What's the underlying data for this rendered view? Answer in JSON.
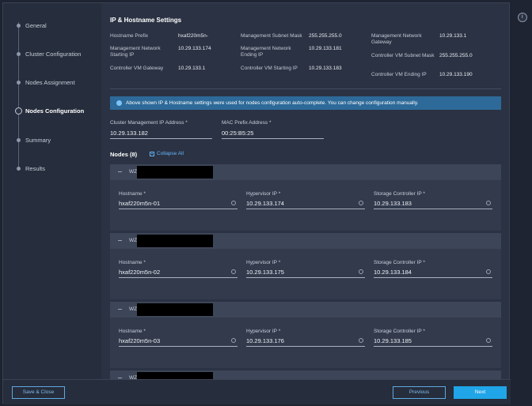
{
  "wizard": {
    "steps": [
      {
        "label": "General",
        "active": false
      },
      {
        "label": "Cluster Configuration",
        "active": false
      },
      {
        "label": "Nodes Assignment",
        "active": false
      },
      {
        "label": "Nodes Configuration",
        "active": true
      },
      {
        "label": "Summary",
        "active": false
      },
      {
        "label": "Results",
        "active": false
      }
    ]
  },
  "settings": {
    "title": "IP & Hostname Settings",
    "col1": [
      {
        "label": "Hostname Prefix",
        "value": "hxaf220m5n-"
      },
      {
        "label": "Management Network Starting IP",
        "value": "10.29.133.174"
      },
      {
        "label": "Controller VM Gateway",
        "value": "10.29.133.1"
      }
    ],
    "col2": [
      {
        "label": "Management Subnet Mask",
        "value": "255.255.255.0"
      },
      {
        "label": "Management Network Ending IP",
        "value": "10.29.133.181"
      },
      {
        "label": "Controller VM Starting IP",
        "value": "10.29.133.183"
      }
    ],
    "col3": [
      {
        "label": "Management Network Gateway",
        "value": "10.29.133.1"
      },
      {
        "label": "Controller VM Subnet Mask",
        "value": "255.255.255.0"
      },
      {
        "label": "Controller VM Ending IP",
        "value": "10.29.133.190"
      }
    ]
  },
  "banner": {
    "text": "Above shown IP & Hostname settings were used for nodes configuration auto-complete. You can change configuration manually."
  },
  "cluster": {
    "mgmt_ip_label": "Cluster Management IP Address *",
    "mgmt_ip_value": "10.29.133.182",
    "mac_label": "MAC Prefix Address *",
    "mac_value": "00:25:B5:25"
  },
  "nodes": {
    "title": "Nodes (8)",
    "collapse_label": "Collapse All",
    "hostname_label": "Hostname *",
    "hypervisor_label": "Hypervisor IP *",
    "storage_label": "Storage Controller IP *",
    "items": [
      {
        "prefix": "WZ",
        "hostname": "hxaf220m5n-01",
        "hypervisor_ip": "10.29.133.174",
        "storage_ip": "10.29.133.183"
      },
      {
        "prefix": "WZ",
        "hostname": "hxaf220m5n-02",
        "hypervisor_ip": "10.29.133.175",
        "storage_ip": "10.29.133.184"
      },
      {
        "prefix": "WZ",
        "hostname": "hxaf220m5n-03",
        "hypervisor_ip": "10.29.133.176",
        "storage_ip": "10.29.133.185"
      },
      {
        "prefix": "WZ"
      }
    ]
  },
  "footer": {
    "save_close": "Save & Close",
    "previous": "Previous",
    "next": "Next"
  },
  "icons": {
    "help": "info-icon",
    "banner": "info-icon",
    "collapse": "collapse-box-icon",
    "node_toggle": "minus-icon",
    "field_hint": "info-circle-icon"
  }
}
